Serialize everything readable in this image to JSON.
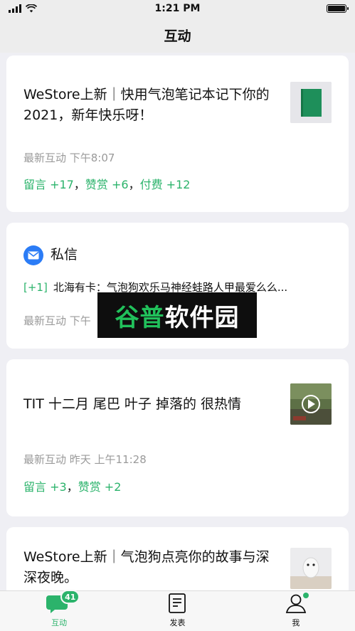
{
  "status": {
    "time": "1:21 PM",
    "battery_level": 1.0
  },
  "nav": {
    "title": "互动"
  },
  "cards": [
    {
      "title": "WeStore上新｜快用气泡笔记本记下你的2021，新年快乐呀！",
      "meta": "最新互动 下午8:07",
      "stats": [
        "留言 +17",
        "赞赏 +6",
        "付费 +12"
      ],
      "thumb": "green-notebook"
    },
    {
      "title": "TIT 十二月 尾巴 叶子 掉落的 很热情",
      "meta": "最新互动 昨天 上午11:28",
      "stats": [
        "留言 +3",
        "赞赏 +2"
      ],
      "thumb": "video-thumbnail"
    },
    {
      "title": "WeStore上新｜气泡狗点亮你的故事与深深夜晚。",
      "thumb": "plush-toy"
    }
  ],
  "dm": {
    "title": "私信",
    "count": "[+1]",
    "preview": "北海有卡：气泡狗欢乐马神经蛙路人甲最爱么么...",
    "meta": "最新互动 下午"
  },
  "stat_separator": "，",
  "watermark": {
    "part1": "谷普",
    "part2": "软件园"
  },
  "tabs": [
    {
      "label": "互动",
      "badge": "41",
      "icon": "chat-icon",
      "active": true
    },
    {
      "label": "发表",
      "icon": "document-icon",
      "active": false
    },
    {
      "label": "我",
      "icon": "person-icon",
      "active": false
    }
  ],
  "colors": {
    "accent": "#2bb36b",
    "dm_icon": "#2b7cf6",
    "background": "#efeff4"
  }
}
